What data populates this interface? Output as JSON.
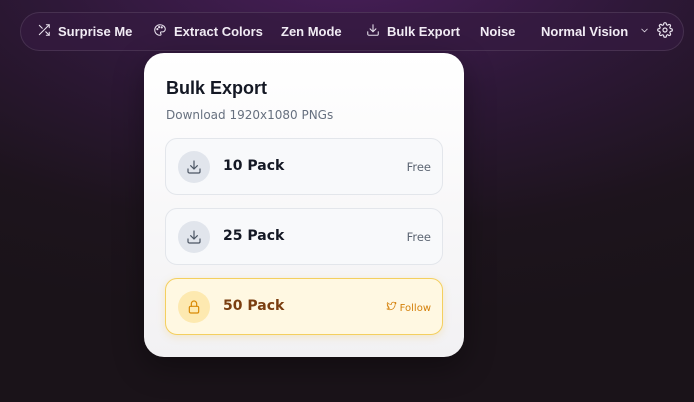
{
  "toolbar": {
    "items": [
      {
        "label": "Surprise Me",
        "icon": "shuffle-icon"
      },
      {
        "label": "Extract Colors",
        "icon": "palette-icon"
      },
      {
        "label": "Zen Mode",
        "icon": ""
      },
      {
        "label": "Bulk Export",
        "icon": "download-icon"
      },
      {
        "label": "Noise",
        "icon": ""
      },
      {
        "label": "Normal Vision",
        "icon": "chevron-down-icon"
      }
    ],
    "settings_icon": "gear-icon"
  },
  "popover": {
    "title": "Bulk Export",
    "subtitle": "Download 1920x1080 PNGs",
    "options": [
      {
        "label": "10 Pack",
        "tag": "Free",
        "icon": "download-icon",
        "locked": false
      },
      {
        "label": "25 Pack",
        "tag": "Free",
        "icon": "download-icon",
        "locked": false
      },
      {
        "label": "50 Pack",
        "tag": "Follow",
        "icon": "lock-icon",
        "tag_icon": "twitter-icon",
        "locked": true
      }
    ]
  },
  "colors": {
    "accent_locked": "#d4800a",
    "locked_background": "#fff8e2"
  }
}
